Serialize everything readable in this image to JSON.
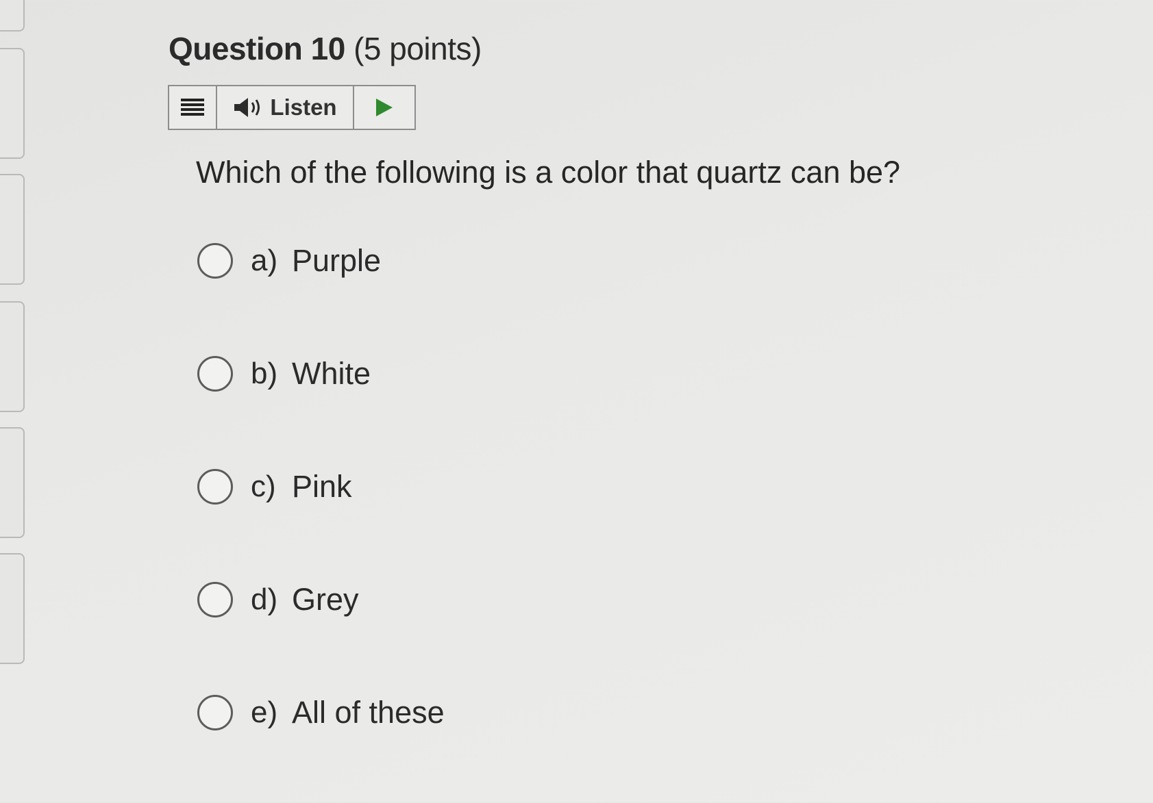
{
  "question": {
    "title_main": "Question 10",
    "title_points": "(5 points)",
    "text": "Which of the following is a color that quartz can be?"
  },
  "listen_toolbar": {
    "menu_icon": "hamburger-menu-icon",
    "speaker_icon": "speaker-icon",
    "listen_label": "Listen",
    "play_icon": "play-icon",
    "play_color": "#2f8a2f"
  },
  "options": [
    {
      "letter": "a)",
      "label": "Purple",
      "selected": false
    },
    {
      "letter": "b)",
      "label": "White",
      "selected": false
    },
    {
      "letter": "c)",
      "label": "Pink",
      "selected": false
    },
    {
      "letter": "d)",
      "label": "Grey",
      "selected": false
    },
    {
      "letter": "e)",
      "label": "All of these",
      "selected": false
    }
  ]
}
